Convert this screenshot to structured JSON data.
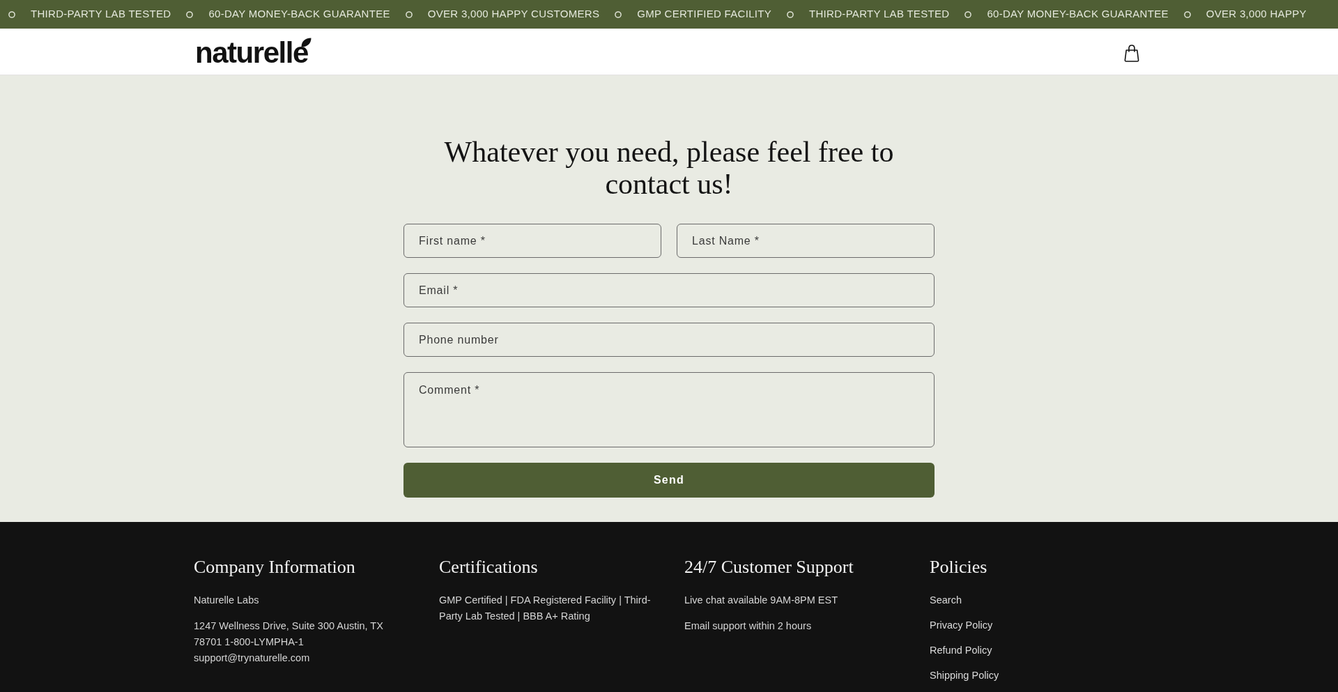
{
  "announcement_bar": {
    "items": [
      "THIRD-PARTY LAB TESTED",
      "60-DAY MONEY-BACK GUARANTEE",
      "OVER 3,000 HAPPY CUSTOMERS",
      "GMP CERTIFIED FACILITY",
      "THIRD-PARTY LAB TESTED",
      "60-DAY MONEY-BACK GUARANTEE",
      "OVER 3,000 HAPPY"
    ]
  },
  "header": {
    "logo": "naturelle"
  },
  "contact": {
    "heading": "Whatever you need, please feel free to contact us!",
    "rows": [
      [
        {
          "kind": "input",
          "placeholder": "First name *"
        },
        {
          "kind": "input",
          "placeholder": "Last Name *"
        }
      ],
      [
        {
          "kind": "input",
          "placeholder": "Email *"
        }
      ],
      [
        {
          "kind": "input",
          "placeholder": "Phone number"
        }
      ],
      [
        {
          "kind": "textarea",
          "placeholder": "Comment *"
        }
      ]
    ],
    "submit": "Send"
  },
  "footer": {
    "columns": [
      {
        "heading": "Company Information",
        "kind": "text",
        "items": [
          "Naturelle Labs",
          "1247 Wellness Drive, Suite 300 Austin, TX 78701 1-800-LYMPHA-1 support@trynaturelle.com"
        ]
      },
      {
        "heading": "Certifications",
        "kind": "text",
        "items": [
          "GMP Certified | FDA Registered Facility | Third-Party Lab Tested | BBB A+ Rating"
        ]
      },
      {
        "heading": "24/7 Customer Support",
        "kind": "text",
        "items": [
          "Live chat available 9AM-8PM EST",
          "Email support within 2 hours"
        ]
      },
      {
        "heading": "Policies",
        "kind": "links",
        "items": [
          "Search",
          "Privacy Policy",
          "Refund Policy",
          "Shipping Policy"
        ]
      }
    ]
  }
}
